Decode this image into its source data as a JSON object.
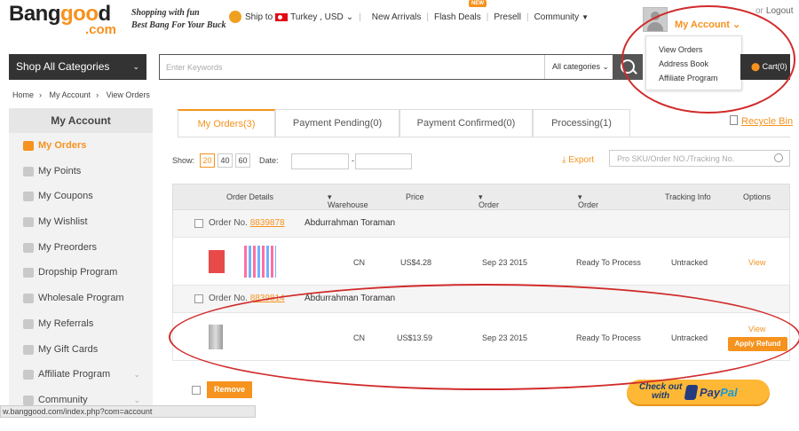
{
  "brand": {
    "logo_part1": "Bang",
    "logo_o1": "g",
    "logo_o2": "oo",
    "logo_part2": "d",
    "logo_com": ".com",
    "tagline1": "Shopping with fun",
    "tagline2": "Best Bang For Your Buck"
  },
  "topnav": {
    "ship_to": "Ship to",
    "country": "Turkey , USD",
    "new_arrivals": "New Arrivals",
    "flash_deals": "Flash Deals",
    "presell": "Presell",
    "community": "Community",
    "new_badge": "NEW"
  },
  "account": {
    "label": "My Account",
    "or": "or",
    "logout": "Logout"
  },
  "dropdown": [
    "View Orders",
    "Address Book",
    "Affiliate Program"
  ],
  "search": {
    "shop_all": "Shop All Categories",
    "placeholder": "Enter Keywords",
    "categories": "All categories",
    "cart": "Cart(0)"
  },
  "breadcrumb": [
    "Home",
    "My Account",
    "View Orders"
  ],
  "sidebar": {
    "title": "My Account",
    "items": [
      "My Orders",
      "My Points",
      "My Coupons",
      "My Wishlist",
      "My Preorders",
      "Dropship Program",
      "Wholesale Program",
      "My Referrals",
      "My Gift Cards",
      "Affiliate Program",
      "Community"
    ]
  },
  "tabs": [
    "My Orders(3)",
    "Payment Pending(0)",
    "Payment Confirmed(0)",
    "Processing(1)"
  ],
  "recycle": "Recycle Bin",
  "filters": {
    "show": "Show:",
    "pages": [
      "20",
      "40",
      "60"
    ],
    "date": "Date:",
    "dash": "-",
    "export": "Export",
    "order_search_placeholder": "Pro SKU/Order NO./Tracking No."
  },
  "table": {
    "headers": [
      "Order Details",
      "Warehouse",
      "Price",
      "Order Date",
      "Order Status",
      "Tracking Info",
      "Options"
    ],
    "orders": [
      {
        "label": "Order No.",
        "number": "8839878",
        "customer": "Abdurrahman Toraman",
        "warehouse": "CN",
        "price": "US$4.28",
        "date": "Sep 23 2015",
        "status": "Ready To Process",
        "tracking": "Untracked",
        "option": "View"
      },
      {
        "label": "Order No.",
        "number": "8839814",
        "customer": "Abdurrahman Toraman",
        "warehouse": "CN",
        "price": "US$13.59",
        "date": "Sep 23 2015",
        "status": "Ready To Process",
        "tracking": "Untracked",
        "option": "View",
        "option2": "Apply Refund"
      }
    ]
  },
  "remove": "Remove",
  "paypal": {
    "checkout1": "Check out",
    "checkout2": "with",
    "pay": "Pay",
    "pal": "Pal"
  },
  "statusbar": "w.banggood.com/index.php?com=account",
  "colors": {
    "accent": "#f6921e",
    "annotation": "#d12b2b",
    "dark": "#333333"
  }
}
